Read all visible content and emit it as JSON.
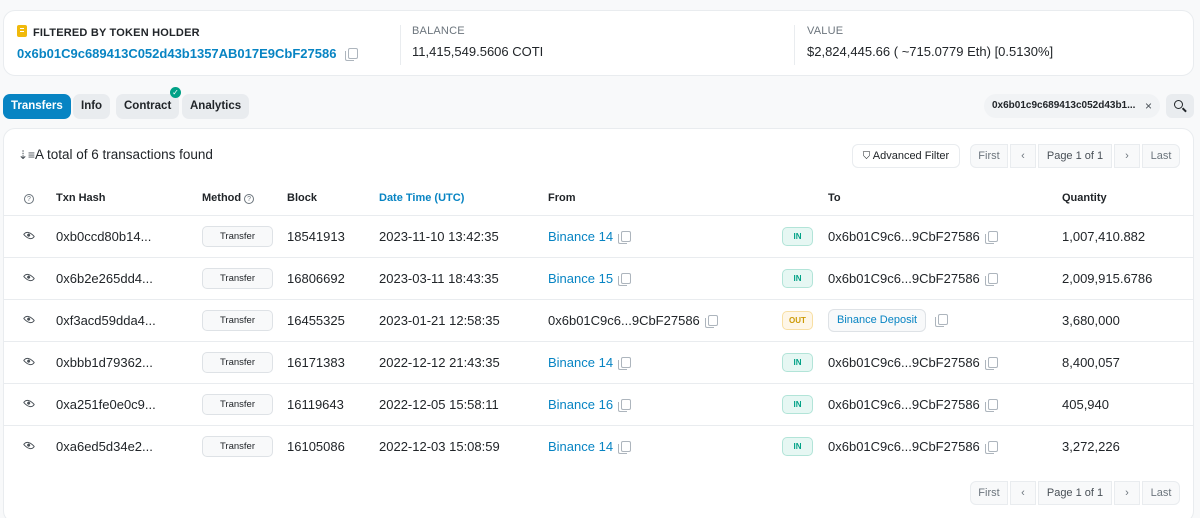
{
  "holder": {
    "label": "FILTERED BY TOKEN HOLDER",
    "address": "0x6b01C9c689413C052d43b1357AB017E9CbF27586"
  },
  "balance": {
    "label": "BALANCE",
    "value": "11,415,549.5606 COTI"
  },
  "value": {
    "label": "VALUE",
    "value": "$2,824,445.66 ( ~715.0779 Eth) [0.5130%]"
  },
  "tabs": [
    {
      "label": "Transfers",
      "active": true
    },
    {
      "label": "Info",
      "active": false
    },
    {
      "label": "Contract",
      "active": false,
      "verified": true
    },
    {
      "label": "Analytics",
      "active": false
    }
  ],
  "filter_chip": {
    "text": "0x6b01c9c689413c052d43b1...",
    "close": "×"
  },
  "summary": "A total of 6 transactions found",
  "advanced_filter": "Advanced Filter",
  "pagination": {
    "first": "First",
    "prev": "‹",
    "page": "Page 1 of 1",
    "next": "›",
    "last": "Last"
  },
  "columns": {
    "txn_hash": "Txn Hash",
    "method": "Method",
    "block": "Block",
    "datetime": "Date Time (UTC)",
    "from": "From",
    "to": "To",
    "quantity": "Quantity"
  },
  "rows": [
    {
      "hash": "0xb0ccd80b14...",
      "method": "Transfer",
      "block": "18541913",
      "time": "2023-11-10 13:42:35",
      "from": "Binance 14",
      "from_is_link": true,
      "dir": "IN",
      "to": "0x6b01C9c6...9CbF27586",
      "to_is_tag": false,
      "qty": "1,007,410.882"
    },
    {
      "hash": "0x6b2e265dd4...",
      "method": "Transfer",
      "block": "16806692",
      "time": "2023-03-11 18:43:35",
      "from": "Binance 15",
      "from_is_link": true,
      "dir": "IN",
      "to": "0x6b01C9c6...9CbF27586",
      "to_is_tag": false,
      "qty": "2,009,915.6786"
    },
    {
      "hash": "0xf3acd59dda4...",
      "method": "Transfer",
      "block": "16455325",
      "time": "2023-01-21 12:58:35",
      "from": "0x6b01C9c6...9CbF27586",
      "from_is_link": false,
      "dir": "OUT",
      "to": "Binance Deposit",
      "to_is_tag": true,
      "qty": "3,680,000"
    },
    {
      "hash": "0xbbb1d79362...",
      "method": "Transfer",
      "block": "16171383",
      "time": "2022-12-12 21:43:35",
      "from": "Binance 14",
      "from_is_link": true,
      "dir": "IN",
      "to": "0x6b01C9c6...9CbF27586",
      "to_is_tag": false,
      "qty": "8,400,057"
    },
    {
      "hash": "0xa251fe0e0c9...",
      "method": "Transfer",
      "block": "16119643",
      "time": "2022-12-05 15:58:11",
      "from": "Binance 16",
      "from_is_link": true,
      "dir": "IN",
      "to": "0x6b01C9c6...9CbF27586",
      "to_is_tag": false,
      "qty": "405,940"
    },
    {
      "hash": "0xa6ed5d34e2...",
      "method": "Transfer",
      "block": "16105086",
      "time": "2022-12-03 15:08:59",
      "from": "Binance 14",
      "from_is_link": true,
      "dir": "IN",
      "to": "0x6b01C9c6...9CbF27586",
      "to_is_tag": false,
      "qty": "3,272,226"
    }
  ],
  "colors": {
    "accent": "#0784c3",
    "in": "#00a186",
    "out": "#cc9a06"
  }
}
